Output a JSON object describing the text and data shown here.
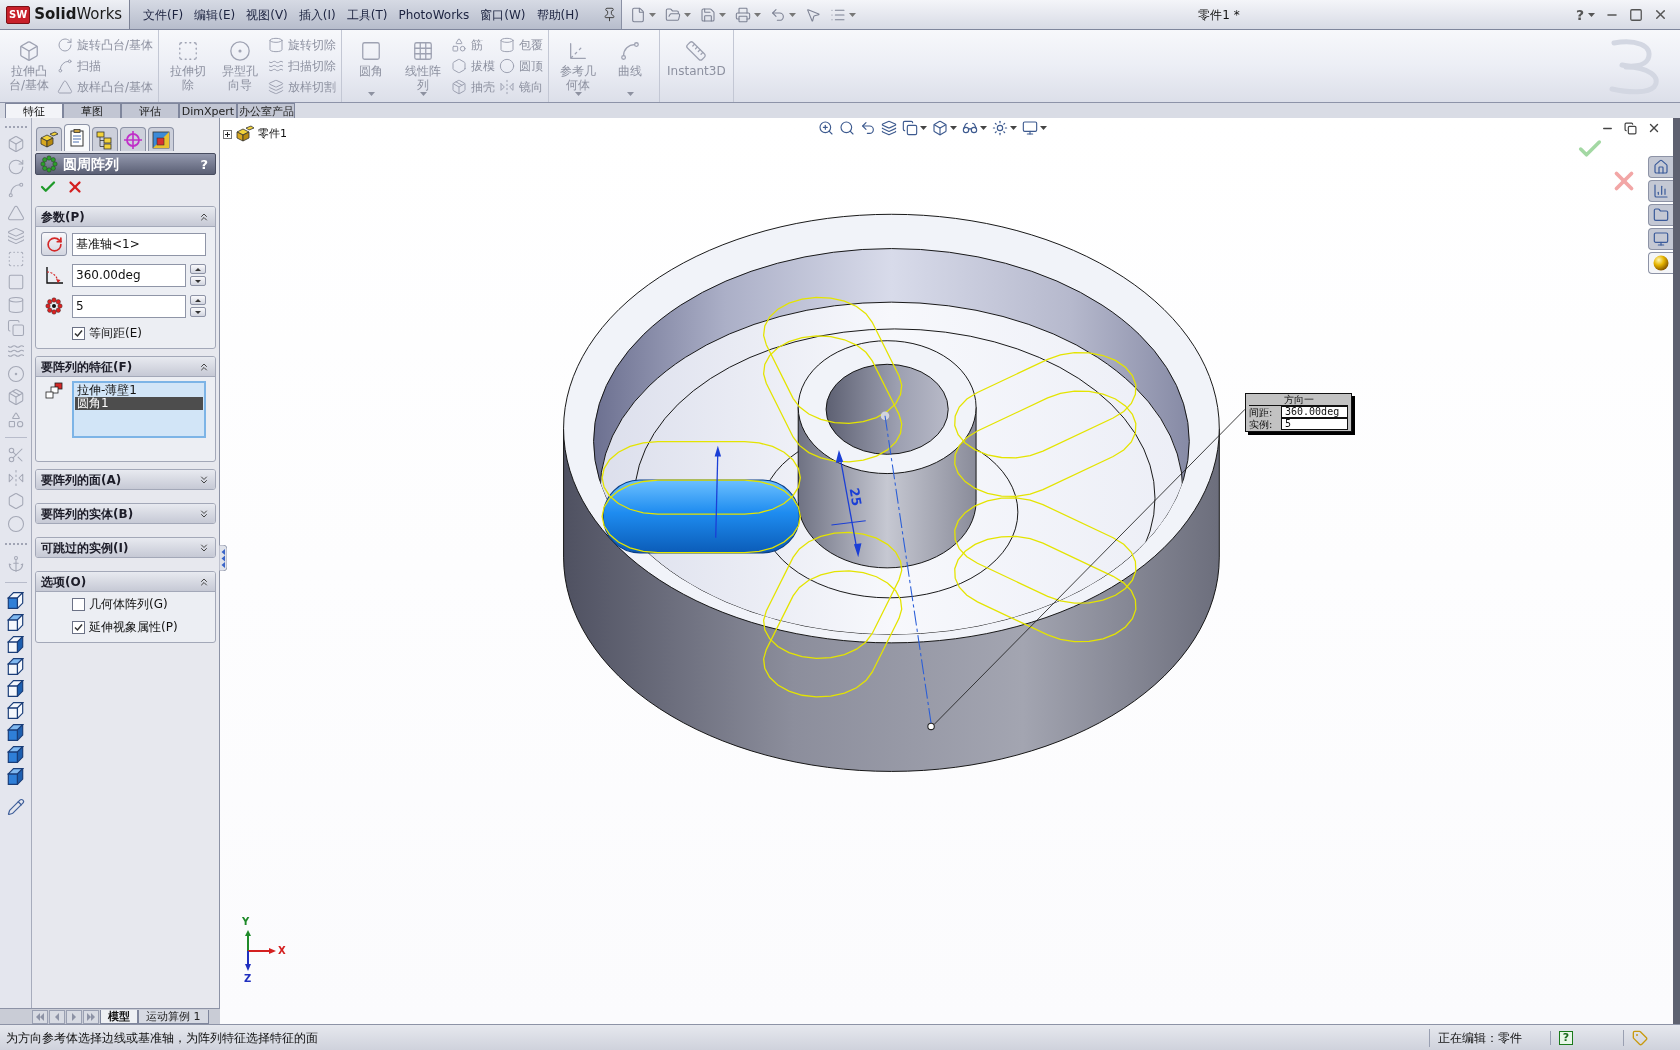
{
  "app": {
    "logo_mark": "SW",
    "name": "**Solid**Works"
  },
  "menu": [
    "文件(F)",
    "编辑(E)",
    "视图(V)",
    "插入(I)",
    "工具(T)",
    "PhotoWorks",
    "窗口(W)",
    "帮助(H)"
  ],
  "window": {
    "title": "零件1 *",
    "help": "?"
  },
  "ribbon": {
    "sections": [
      {
        "items": [
          {
            "kind": "large",
            "label": "拉伸凸台/基体",
            "disabled": true,
            "dropdown": false
          },
          {
            "kind": "stack",
            "items": [
              {
                "label": "旋转凸台/基体",
                "disabled": true
              },
              {
                "label": "扫描",
                "disabled": true
              },
              {
                "label": "放样凸台/基体",
                "disabled": true
              }
            ]
          }
        ]
      },
      {
        "items": [
          {
            "kind": "large",
            "label": "拉伸切除",
            "disabled": true,
            "dropdown": false
          },
          {
            "kind": "large",
            "label": "异型孔向导",
            "disabled": true,
            "dropdown": false
          },
          {
            "kind": "stack",
            "items": [
              {
                "label": "旋转切除",
                "disabled": true
              },
              {
                "label": "扫描切除",
                "disabled": true
              },
              {
                "label": "放样切割",
                "disabled": true
              }
            ]
          }
        ]
      },
      {
        "items": [
          {
            "kind": "large",
            "label": "圆角",
            "disabled": true,
            "dropdown": true
          },
          {
            "kind": "large",
            "label": "线性阵列",
            "disabled": true,
            "dropdown": true
          },
          {
            "kind": "stack",
            "items": [
              {
                "label": "筋",
                "disabled": true
              },
              {
                "label": "拔模",
                "disabled": true
              },
              {
                "label": "抽壳",
                "disabled": true
              }
            ]
          },
          {
            "kind": "stack",
            "items": [
              {
                "label": "包覆",
                "disabled": true
              },
              {
                "label": "圆顶",
                "disabled": true
              },
              {
                "label": "镜向",
                "disabled": true
              }
            ]
          }
        ]
      },
      {
        "items": [
          {
            "kind": "large",
            "label": "参考几何体",
            "disabled": true,
            "dropdown": true
          },
          {
            "kind": "large",
            "label": "曲线",
            "disabled": true,
            "dropdown": true
          }
        ]
      },
      {
        "items": [
          {
            "kind": "large",
            "label": "Instant3D",
            "disabled": true,
            "dropdown": false
          }
        ]
      }
    ]
  },
  "command_tabs": [
    {
      "label": "特征",
      "selected": true
    },
    {
      "label": "草图",
      "selected": false
    },
    {
      "label": "评估",
      "selected": false
    },
    {
      "label": "DimXpert",
      "selected": false
    },
    {
      "label": "办公室产品",
      "selected": false
    }
  ],
  "manager_tabs": [
    {
      "selected": false
    },
    {
      "selected": true
    },
    {
      "selected": false
    },
    {
      "selected": false
    },
    {
      "selected": false
    }
  ],
  "property_manager": {
    "title": "圆周阵列",
    "help": "?",
    "groups": [
      {
        "title": "参数(P)",
        "expanded": true,
        "rows": [
          {
            "kind": "direction",
            "value": "基准轴<1>"
          },
          {
            "kind": "angle",
            "value": "360.00deg"
          },
          {
            "kind": "count",
            "value": "5"
          },
          {
            "kind": "checkbox",
            "label": "等间距(E)",
            "checked": true
          }
        ]
      },
      {
        "title": "要阵列的特征(F)",
        "expanded": true,
        "rows": [
          {
            "kind": "list",
            "items": [
              {
                "label": "拉伸-薄壁1",
                "selected": false
              },
              {
                "label": "圆角1",
                "selected": true
              }
            ]
          }
        ]
      },
      {
        "title": "要阵列的面(A)",
        "expanded": false
      },
      {
        "title": "要阵列的实体(B)",
        "expanded": false
      },
      {
        "title": "可跳过的实例(I)",
        "expanded": false
      },
      {
        "title": "选项(O)",
        "expanded": true,
        "rows": [
          {
            "kind": "checkbox",
            "label": "几何体阵列(G)",
            "checked": false
          },
          {
            "kind": "checkbox",
            "label": "延伸视象属性(P)",
            "checked": true
          }
        ]
      }
    ]
  },
  "bottom_tabs": [
    {
      "label": "模型",
      "selected": true
    },
    {
      "label": "运动算例 1",
      "selected": false
    }
  ],
  "graphics": {
    "tree_root": "零件1",
    "callout": {
      "title": "方向一",
      "rows": [
        {
          "label": "间距:",
          "value": "360.00deg"
        },
        {
          "label": "实例:",
          "value": "5"
        }
      ]
    },
    "dimension": "25",
    "triad": {
      "x": "X",
      "y": "Y",
      "z": "Z"
    }
  },
  "task_pane": [
    {
      "selected": false
    },
    {
      "selected": false
    },
    {
      "selected": false
    },
    {
      "selected": false
    },
    {
      "selected": true
    }
  ],
  "status_bar": {
    "message": "为方向参考体选择边线或基准轴，为阵列特征选择特征的面",
    "mode": "正在编辑：零件",
    "help": "?"
  }
}
